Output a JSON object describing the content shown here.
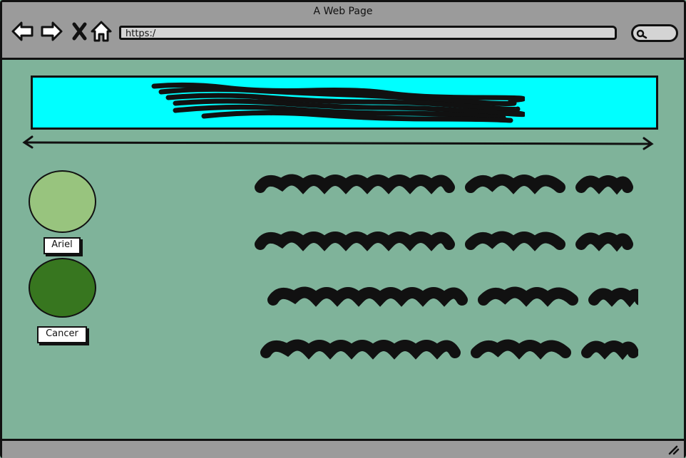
{
  "window": {
    "title": "A Web Page"
  },
  "toolbar": {
    "icons": [
      "back-arrow-icon",
      "forward-arrow-icon",
      "close-x-icon",
      "home-icon"
    ],
    "url": "https:/",
    "search_icon": "search-icon"
  },
  "banner": {
    "color": "#00ffff",
    "content": "scribbled-heading"
  },
  "people": [
    {
      "name": "Ariel",
      "color": "#98c47e"
    },
    {
      "name": "Cancer",
      "color": "#37761f"
    }
  ],
  "text_lines": [
    "scribble-line",
    "scribble-line",
    "scribble-line",
    "scribble-line"
  ],
  "colors": {
    "page_bg": "#7fb39a",
    "chrome": "#9b9b9b",
    "url_bar": "#d4d4d4"
  }
}
